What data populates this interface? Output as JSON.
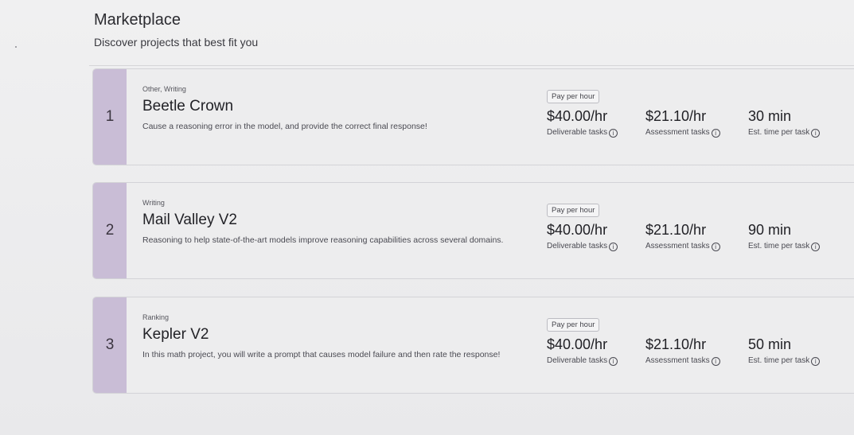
{
  "header": {
    "title": "Marketplace",
    "subtitle": "Discover projects that best fit you"
  },
  "projects": [
    {
      "rank": "1",
      "tags": "Other, Writing",
      "name": "Beetle Crown",
      "description": "Cause a reasoning error in the model, and provide the correct final response!",
      "pay_badge": "Pay per hour",
      "deliverable_rate": "$40.00/hr",
      "deliverable_label": "Deliverable tasks",
      "assessment_rate": "$21.10/hr",
      "assessment_label": "Assessment tasks",
      "est_time": "30 min",
      "est_time_label": "Est. time per task"
    },
    {
      "rank": "2",
      "tags": "Writing",
      "name": "Mail Valley V2",
      "description": "Reasoning to help state-of-the-art models improve reasoning capabilities across several domains.",
      "pay_badge": "Pay per hour",
      "deliverable_rate": "$40.00/hr",
      "deliverable_label": "Deliverable tasks",
      "assessment_rate": "$21.10/hr",
      "assessment_label": "Assessment tasks",
      "est_time": "90 min",
      "est_time_label": "Est. time per task"
    },
    {
      "rank": "3",
      "tags": "Ranking",
      "name": "Kepler V2",
      "description": "In this math project, you will write a prompt that causes model failure and then rate the response!",
      "pay_badge": "Pay per hour",
      "deliverable_rate": "$40.00/hr",
      "deliverable_label": "Deliverable tasks",
      "assessment_rate": "$21.10/hr",
      "assessment_label": "Assessment tasks",
      "est_time": "50 min",
      "est_time_label": "Est. time per task"
    }
  ],
  "icons": {
    "info": "info-circle-icon"
  },
  "colors": {
    "rank_strip": "#c9bdd6",
    "card_bg": "#ededee"
  }
}
